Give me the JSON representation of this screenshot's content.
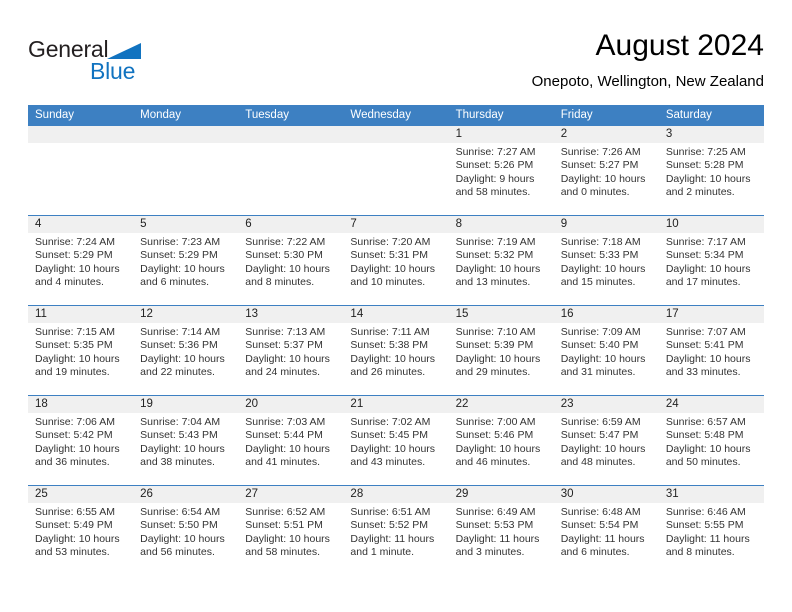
{
  "brand": {
    "name_part1": "General",
    "name_part2": "Blue",
    "triangle_icon": "blue-triangle-icon",
    "color_dark": "#231f20",
    "color_blue": "#1173c0"
  },
  "header": {
    "title": "August 2024",
    "subtitle": "Onepoto, Wellington, New Zealand"
  },
  "theme": {
    "header_blue": "#3d80c2",
    "day_band_gray": "#f0f0f0",
    "text_gray": "#333333"
  },
  "weekdays": [
    "Sunday",
    "Monday",
    "Tuesday",
    "Wednesday",
    "Thursday",
    "Friday",
    "Saturday"
  ],
  "weeks": [
    [
      {
        "day": "",
        "lines": []
      },
      {
        "day": "",
        "lines": []
      },
      {
        "day": "",
        "lines": []
      },
      {
        "day": "",
        "lines": []
      },
      {
        "day": "1",
        "lines": [
          "Sunrise: 7:27 AM",
          "Sunset: 5:26 PM",
          "Daylight: 9 hours",
          "and 58 minutes."
        ]
      },
      {
        "day": "2",
        "lines": [
          "Sunrise: 7:26 AM",
          "Sunset: 5:27 PM",
          "Daylight: 10 hours",
          "and 0 minutes."
        ]
      },
      {
        "day": "3",
        "lines": [
          "Sunrise: 7:25 AM",
          "Sunset: 5:28 PM",
          "Daylight: 10 hours",
          "and 2 minutes."
        ]
      }
    ],
    [
      {
        "day": "4",
        "lines": [
          "Sunrise: 7:24 AM",
          "Sunset: 5:29 PM",
          "Daylight: 10 hours",
          "and 4 minutes."
        ]
      },
      {
        "day": "5",
        "lines": [
          "Sunrise: 7:23 AM",
          "Sunset: 5:29 PM",
          "Daylight: 10 hours",
          "and 6 minutes."
        ]
      },
      {
        "day": "6",
        "lines": [
          "Sunrise: 7:22 AM",
          "Sunset: 5:30 PM",
          "Daylight: 10 hours",
          "and 8 minutes."
        ]
      },
      {
        "day": "7",
        "lines": [
          "Sunrise: 7:20 AM",
          "Sunset: 5:31 PM",
          "Daylight: 10 hours",
          "and 10 minutes."
        ]
      },
      {
        "day": "8",
        "lines": [
          "Sunrise: 7:19 AM",
          "Sunset: 5:32 PM",
          "Daylight: 10 hours",
          "and 13 minutes."
        ]
      },
      {
        "day": "9",
        "lines": [
          "Sunrise: 7:18 AM",
          "Sunset: 5:33 PM",
          "Daylight: 10 hours",
          "and 15 minutes."
        ]
      },
      {
        "day": "10",
        "lines": [
          "Sunrise: 7:17 AM",
          "Sunset: 5:34 PM",
          "Daylight: 10 hours",
          "and 17 minutes."
        ]
      }
    ],
    [
      {
        "day": "11",
        "lines": [
          "Sunrise: 7:15 AM",
          "Sunset: 5:35 PM",
          "Daylight: 10 hours",
          "and 19 minutes."
        ]
      },
      {
        "day": "12",
        "lines": [
          "Sunrise: 7:14 AM",
          "Sunset: 5:36 PM",
          "Daylight: 10 hours",
          "and 22 minutes."
        ]
      },
      {
        "day": "13",
        "lines": [
          "Sunrise: 7:13 AM",
          "Sunset: 5:37 PM",
          "Daylight: 10 hours",
          "and 24 minutes."
        ]
      },
      {
        "day": "14",
        "lines": [
          "Sunrise: 7:11 AM",
          "Sunset: 5:38 PM",
          "Daylight: 10 hours",
          "and 26 minutes."
        ]
      },
      {
        "day": "15",
        "lines": [
          "Sunrise: 7:10 AM",
          "Sunset: 5:39 PM",
          "Daylight: 10 hours",
          "and 29 minutes."
        ]
      },
      {
        "day": "16",
        "lines": [
          "Sunrise: 7:09 AM",
          "Sunset: 5:40 PM",
          "Daylight: 10 hours",
          "and 31 minutes."
        ]
      },
      {
        "day": "17",
        "lines": [
          "Sunrise: 7:07 AM",
          "Sunset: 5:41 PM",
          "Daylight: 10 hours",
          "and 33 minutes."
        ]
      }
    ],
    [
      {
        "day": "18",
        "lines": [
          "Sunrise: 7:06 AM",
          "Sunset: 5:42 PM",
          "Daylight: 10 hours",
          "and 36 minutes."
        ]
      },
      {
        "day": "19",
        "lines": [
          "Sunrise: 7:04 AM",
          "Sunset: 5:43 PM",
          "Daylight: 10 hours",
          "and 38 minutes."
        ]
      },
      {
        "day": "20",
        "lines": [
          "Sunrise: 7:03 AM",
          "Sunset: 5:44 PM",
          "Daylight: 10 hours",
          "and 41 minutes."
        ]
      },
      {
        "day": "21",
        "lines": [
          "Sunrise: 7:02 AM",
          "Sunset: 5:45 PM",
          "Daylight: 10 hours",
          "and 43 minutes."
        ]
      },
      {
        "day": "22",
        "lines": [
          "Sunrise: 7:00 AM",
          "Sunset: 5:46 PM",
          "Daylight: 10 hours",
          "and 46 minutes."
        ]
      },
      {
        "day": "23",
        "lines": [
          "Sunrise: 6:59 AM",
          "Sunset: 5:47 PM",
          "Daylight: 10 hours",
          "and 48 minutes."
        ]
      },
      {
        "day": "24",
        "lines": [
          "Sunrise: 6:57 AM",
          "Sunset: 5:48 PM",
          "Daylight: 10 hours",
          "and 50 minutes."
        ]
      }
    ],
    [
      {
        "day": "25",
        "lines": [
          "Sunrise: 6:55 AM",
          "Sunset: 5:49 PM",
          "Daylight: 10 hours",
          "and 53 minutes."
        ]
      },
      {
        "day": "26",
        "lines": [
          "Sunrise: 6:54 AM",
          "Sunset: 5:50 PM",
          "Daylight: 10 hours",
          "and 56 minutes."
        ]
      },
      {
        "day": "27",
        "lines": [
          "Sunrise: 6:52 AM",
          "Sunset: 5:51 PM",
          "Daylight: 10 hours",
          "and 58 minutes."
        ]
      },
      {
        "day": "28",
        "lines": [
          "Sunrise: 6:51 AM",
          "Sunset: 5:52 PM",
          "Daylight: 11 hours",
          "and 1 minute."
        ]
      },
      {
        "day": "29",
        "lines": [
          "Sunrise: 6:49 AM",
          "Sunset: 5:53 PM",
          "Daylight: 11 hours",
          "and 3 minutes."
        ]
      },
      {
        "day": "30",
        "lines": [
          "Sunrise: 6:48 AM",
          "Sunset: 5:54 PM",
          "Daylight: 11 hours",
          "and 6 minutes."
        ]
      },
      {
        "day": "31",
        "lines": [
          "Sunrise: 6:46 AM",
          "Sunset: 5:55 PM",
          "Daylight: 11 hours",
          "and 8 minutes."
        ]
      }
    ]
  ]
}
